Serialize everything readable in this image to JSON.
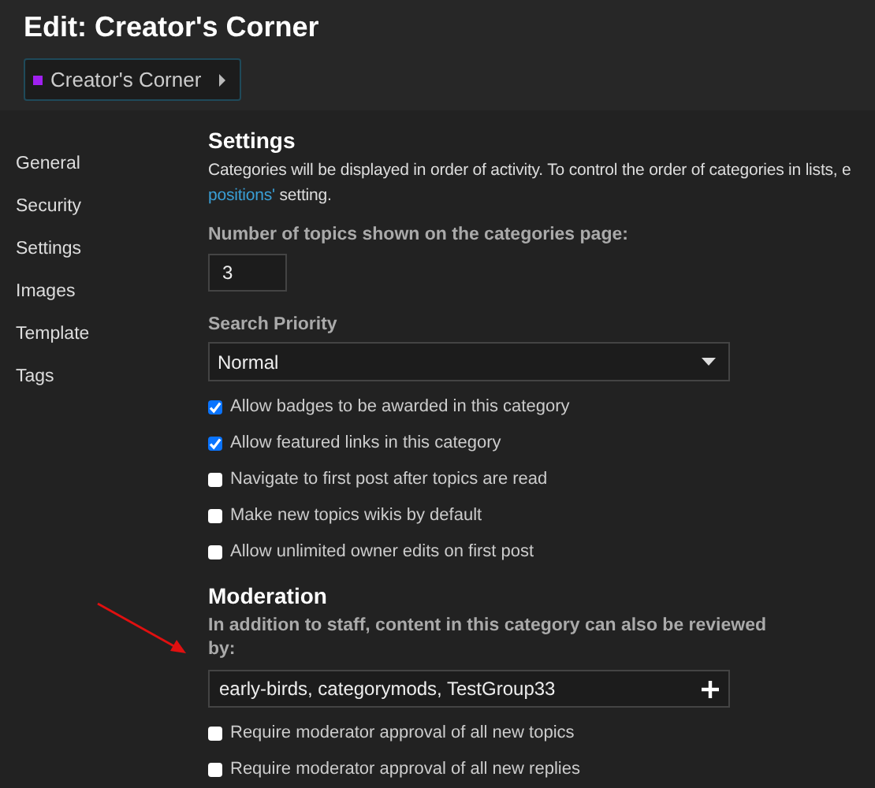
{
  "header": {
    "title": "Edit: Creator's Corner",
    "category_badge": {
      "label": "Creator's Corner",
      "color": "#a020f0"
    }
  },
  "sidebar": {
    "items": [
      "General",
      "Security",
      "Settings",
      "Images",
      "Template",
      "Tags"
    ]
  },
  "settings": {
    "heading": "Settings",
    "description": {
      "line_1": "Categories will be displayed in order of activity. To control the order of categories in lists, e",
      "link": "positions'",
      "line_2_rest": " setting."
    },
    "topics_count": {
      "label": "Number of topics shown on the categories page:",
      "value": "3"
    },
    "search_priority": {
      "label": "Search Priority",
      "value": "Normal"
    },
    "options": [
      {
        "label": "Allow badges to be awarded in this category",
        "checked": true
      },
      {
        "label": "Allow featured links in this category",
        "checked": true
      },
      {
        "label": "Navigate to first post after topics are read",
        "checked": false
      },
      {
        "label": "Make new topics wikis by default",
        "checked": false
      },
      {
        "label": "Allow unlimited owner edits on first post",
        "checked": false
      }
    ]
  },
  "moderation": {
    "heading": "Moderation",
    "reviewers_label": "In addition to staff, content in this category can also be reviewed by:",
    "reviewers_value": "early-birds, categorymods, TestGroup33",
    "options": [
      {
        "label": "Require moderator approval of all new topics",
        "checked": false
      },
      {
        "label": "Require moderator approval of all new replies",
        "checked": false
      }
    ]
  }
}
